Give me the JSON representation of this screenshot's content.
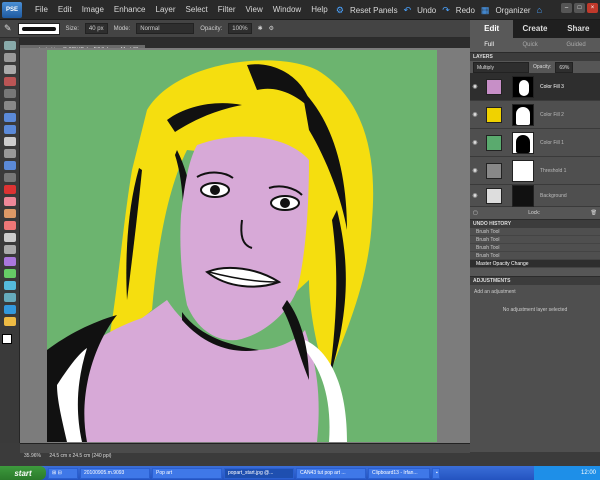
{
  "app": {
    "logo": "PSE",
    "menu": [
      "File",
      "Edit",
      "Image",
      "Enhance",
      "Layer",
      "Select",
      "Filter",
      "View",
      "Window",
      "Help"
    ],
    "reset_panels": "Reset Panels",
    "undo": "Undo",
    "redo": "Redo",
    "organizer": "Organizer"
  },
  "options": {
    "size_label": "Size:",
    "size_value": "40 px",
    "mode_label": "Mode:",
    "mode_value": "Normal",
    "opacity_label": "Opacity:",
    "opacity_value": "100%"
  },
  "tabs": {
    "edit": "Edit",
    "create": "Create",
    "share": "Share",
    "sub": [
      "Full",
      "Quick",
      "Guided"
    ]
  },
  "document": {
    "tab": "popart_start.jpg @ 36%(Color Fill 3, Layer Mask/8)",
    "zoom": "35.96%",
    "doc_info": "24.5 cm x 24.5 cm (240 ppi)"
  },
  "layers": {
    "title": "LAYERS",
    "blend": "Multiply",
    "opacity_label": "Opacity:",
    "opacity_value": "69%",
    "lock_label": "Lock:",
    "items": [
      {
        "name": "Color Fill 3",
        "color": "#c78fc7",
        "selected": true
      },
      {
        "name": "Color Fill 2",
        "color": "#f0d200",
        "selected": false
      },
      {
        "name": "Color Fill 1",
        "color": "#5aaa6e",
        "selected": false
      },
      {
        "name": "Threshold 1",
        "color": "#888888",
        "selected": false
      },
      {
        "name": "Background",
        "color": "#999999",
        "selected": false
      }
    ]
  },
  "history": {
    "title": "UNDO HISTORY",
    "items": [
      "Brush Tool",
      "Brush Tool",
      "Brush Tool",
      "Brush Tool",
      "Master Opacity Change"
    ]
  },
  "adjustments": {
    "title": "ADJUSTMENTS",
    "add_label": "Add an adjustment",
    "none_label": "No adjustment layer selected"
  },
  "taskbar": {
    "start": "start",
    "items": [
      "20100905.m.9093",
      "Pop art",
      "popart_start.jpg @...",
      "CAN43 tut pop art ...",
      "Clipboard13 - Irfan...",
      "Adobe Photoshop ..."
    ],
    "clock": "12:00"
  },
  "colors": {
    "green": "#6cb46f",
    "yellow": "#f5de0f",
    "pink": "#d7a9d7"
  }
}
